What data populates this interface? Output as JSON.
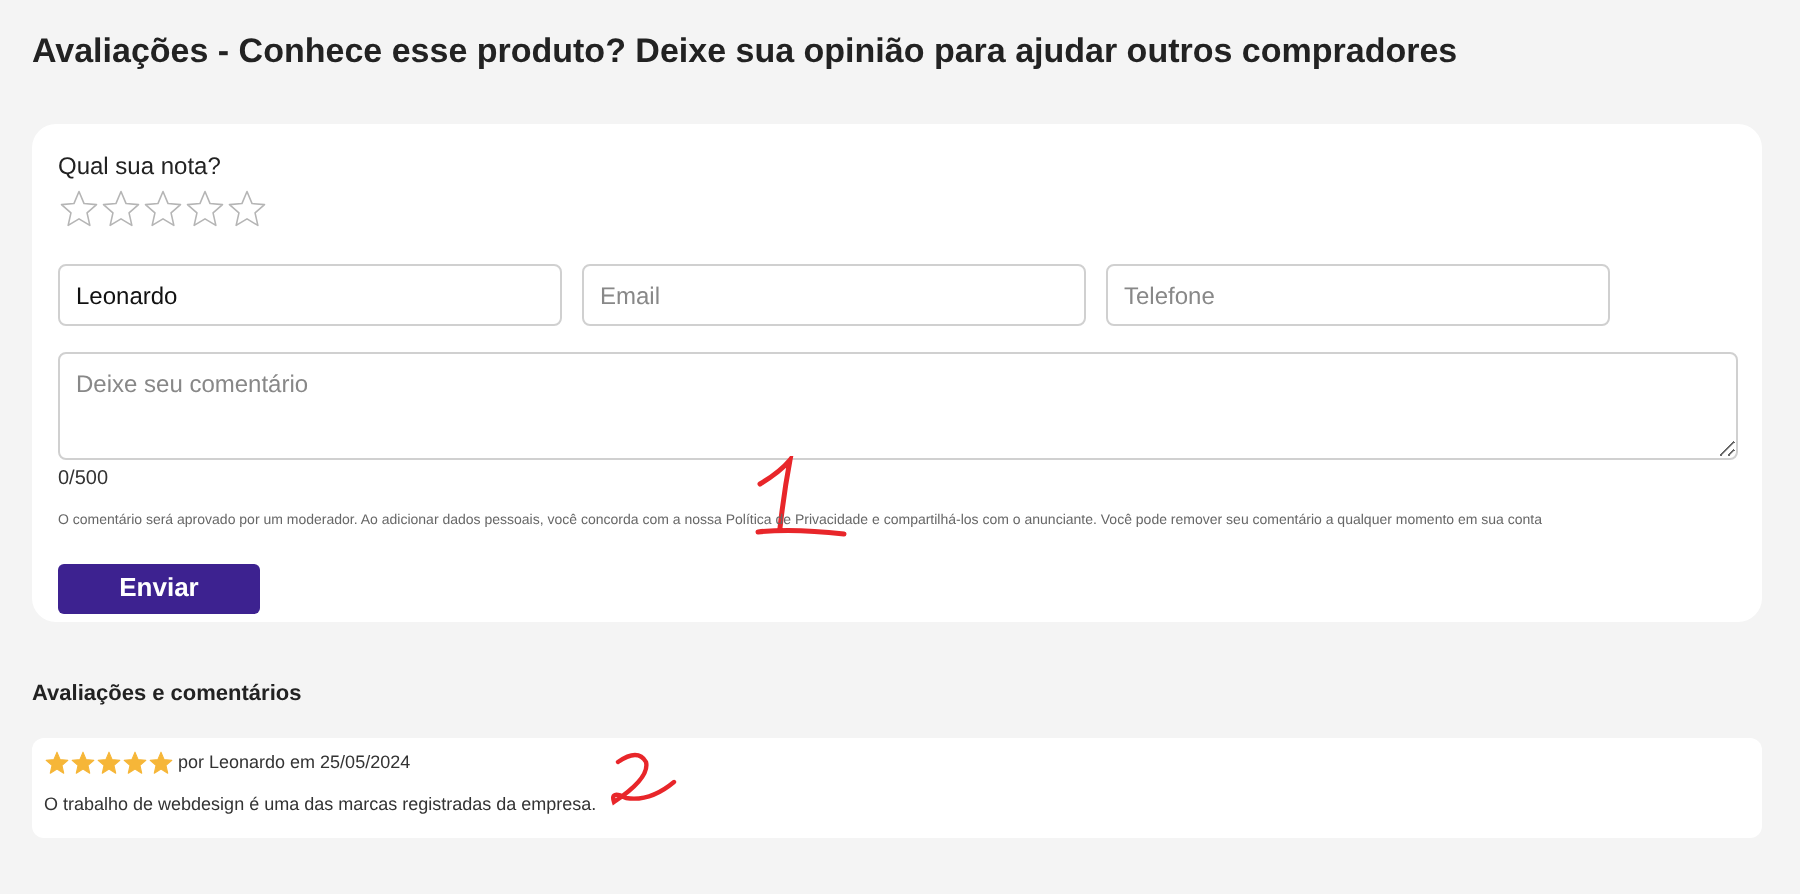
{
  "page_title": "Avaliações - Conhece esse produto? Deixe sua opinião para ajudar outros compradores",
  "form": {
    "rating_label": "Qual sua nota?",
    "stars": 0,
    "fields": [
      {
        "value": "Leonardo"
      },
      {
        "placeholder": "Email"
      },
      {
        "placeholder": "Telefone"
      }
    ],
    "comment": {
      "placeholder": "Deixe seu comentário"
    },
    "counter": "0/500",
    "notice": "O comentário será aprovado por um moderador. Ao adicionar dados pessoais, você concorda com a nossa Política de Privacidade e compartilhá-los com o anunciante. Você pode remover seu comentário a qualquer momento em sua conta",
    "submit": "Enviar"
  },
  "reviews_heading": "Avaliações e comentários",
  "reviews": [
    {
      "stars": 5,
      "byline": "por Leonardo em 25/05/2024",
      "text": "O trabalho de webdesign é uma das marcas registradas da empresa."
    }
  ]
}
